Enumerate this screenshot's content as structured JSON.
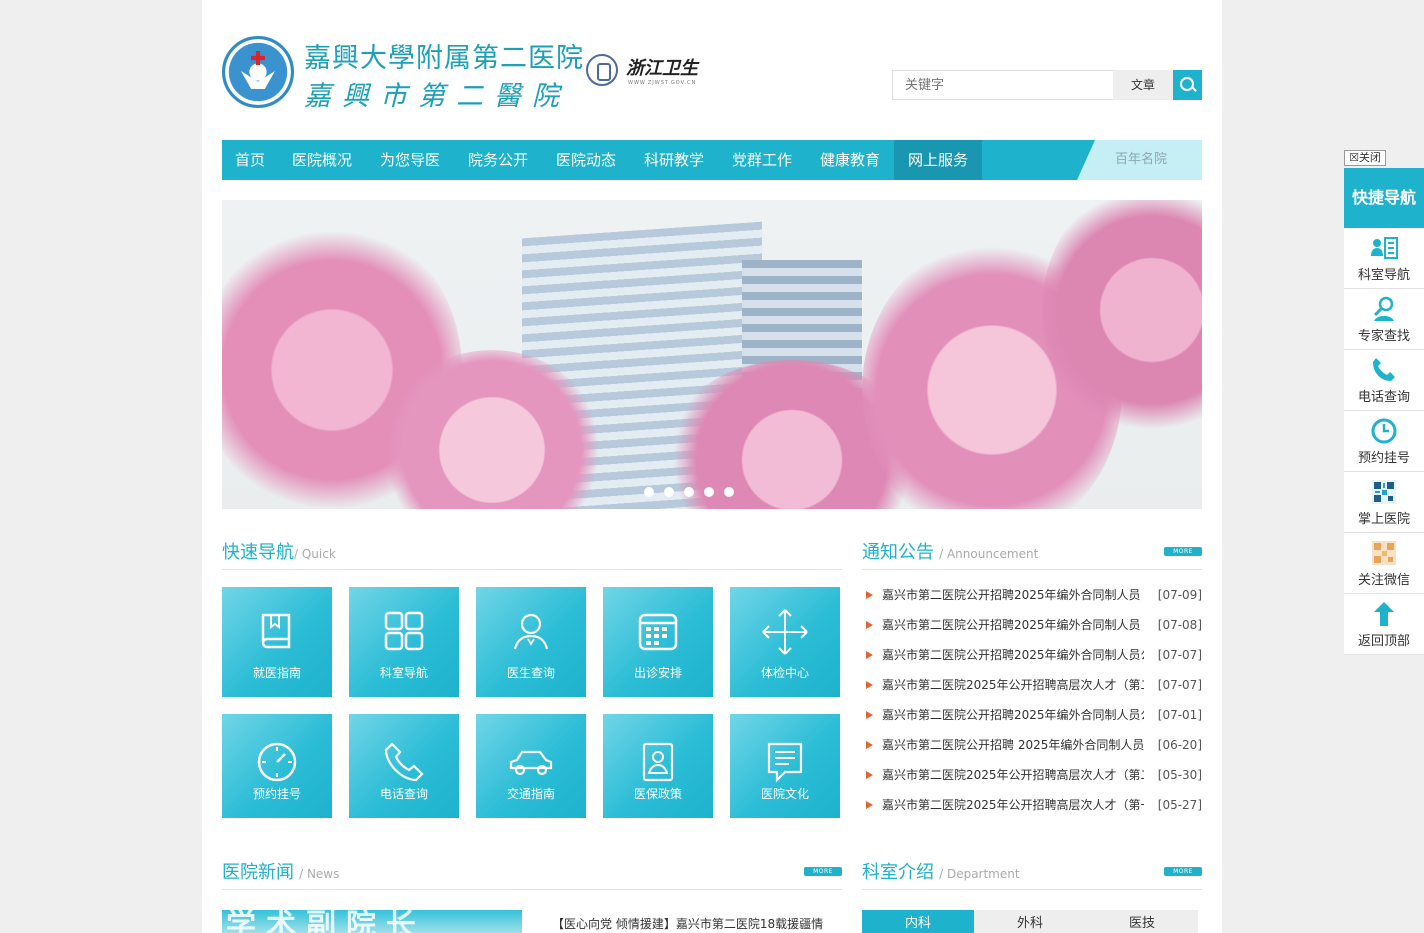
{
  "header": {
    "logo_line1": "嘉興大學附属第二医院",
    "logo_line2": "嘉興市第二醫院",
    "partner_logo_text": "浙江卫生",
    "partner_logo_url": "WWW.ZJWST.GOV.CN",
    "search_placeholder": "关键字",
    "search_type": "文章"
  },
  "nav": {
    "items": [
      "首页",
      "医院概况",
      "为您导医",
      "院务公开",
      "医院动态",
      "科研教学",
      "党群工作",
      "健康教育",
      "网上服务"
    ],
    "active_index": 8,
    "right_label": "百年名院"
  },
  "banner": {
    "slide_count": 5,
    "current_slide": 2
  },
  "quick_nav": {
    "title": "快速导航",
    "subtitle": "/ Quick",
    "tiles": [
      {
        "label": "就医指南",
        "icon": "book-icon"
      },
      {
        "label": "科室导航",
        "icon": "grid-icon"
      },
      {
        "label": "医生查询",
        "icon": "doctor-icon"
      },
      {
        "label": "出诊安排",
        "icon": "calendar-icon"
      },
      {
        "label": "体检中心",
        "icon": "move-arrows-icon"
      },
      {
        "label": "预约挂号",
        "icon": "clock-icon"
      },
      {
        "label": "电话查询",
        "icon": "phone-icon"
      },
      {
        "label": "交通指南",
        "icon": "car-icon"
      },
      {
        "label": "医保政策",
        "icon": "id-card-icon"
      },
      {
        "label": "医院文化",
        "icon": "document-icon"
      }
    ]
  },
  "notices": {
    "title": "通知公告",
    "subtitle": "/ Announcement",
    "more": "MORE",
    "items": [
      {
        "title": "嘉兴市第二医院公开招聘2025年编外合同制人员",
        "date": "[07-09]"
      },
      {
        "title": "嘉兴市第二医院公开招聘2025年编外合同制人员",
        "date": "[07-08]"
      },
      {
        "title": "嘉兴市第二医院公开招聘2025年编外合同制人员公告",
        "date": "[07-07]"
      },
      {
        "title": "嘉兴市第二医院2025年公开招聘高层次人才（第二批）",
        "date": "[07-07]"
      },
      {
        "title": "嘉兴市第二医院公开招聘2025年编外合同制人员公告",
        "date": "[07-01]"
      },
      {
        "title": "嘉兴市第二医院公开招聘 2025年编外合同制人员",
        "date": "[06-20]"
      },
      {
        "title": "嘉兴市第二医院2025年公开招聘高层次人才（第二批）",
        "date": "[05-30]"
      },
      {
        "title": "嘉兴市第二医院2025年公开招聘高层次人才（第一批）",
        "date": "[05-27]"
      }
    ]
  },
  "news": {
    "title": "医院新闻",
    "subtitle": "/ News",
    "more": "MORE",
    "image_text": "学术副院长",
    "headline": "【医心向党 倾情援建】嘉兴市第二医院18载援疆情"
  },
  "departments": {
    "title": "科室介绍",
    "subtitle": "/ Department",
    "more": "MORE",
    "tabs": [
      "内科",
      "外科",
      "医技"
    ],
    "active_tab": 0
  },
  "side_panel": {
    "close": "☒关闭",
    "title": "快捷导航",
    "items": [
      {
        "label": "科室导航",
        "icon": "list-person-icon"
      },
      {
        "label": "专家查找",
        "icon": "expert-search-icon"
      },
      {
        "label": "电话查询",
        "icon": "phone-icon"
      },
      {
        "label": "预约挂号",
        "icon": "clock-icon"
      },
      {
        "label": "掌上医院",
        "icon": "qr-code-icon"
      },
      {
        "label": "关注微信",
        "icon": "qr-code-icon"
      },
      {
        "label": "返回顶部",
        "icon": "arrow-up-icon"
      }
    ]
  },
  "colors": {
    "primary": "#1eb2cc",
    "primary_dark": "#1a97b0",
    "notice_arrow": "#e06535"
  }
}
